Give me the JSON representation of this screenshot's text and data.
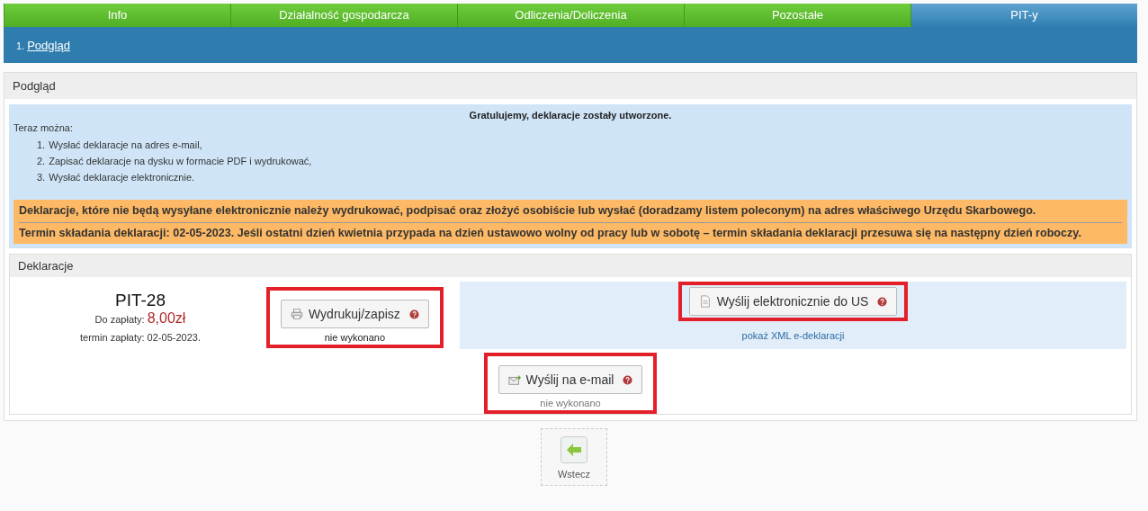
{
  "tabs": [
    {
      "label": "Info",
      "selected": false
    },
    {
      "label": "Działalność gospodarcza",
      "selected": false
    },
    {
      "label": "Odliczenia/Doliczenia",
      "selected": false
    },
    {
      "label": "Pozostałe",
      "selected": false
    },
    {
      "label": "PIT-y",
      "selected": true
    }
  ],
  "steps": [
    {
      "number": "1.",
      "label": "Podgląd",
      "selected": true
    }
  ],
  "preview_panel": {
    "title": "Podgląd",
    "info": {
      "heading": "Gratulujemy, deklaracje zostały utworzone.",
      "intro": "Teraz można:",
      "items": [
        {
          "number": "1.",
          "text": "Wysłać deklaracje na adres e-mail,"
        },
        {
          "number": "2.",
          "text": "Zapisać deklaracje na dysku w formacie PDF i wydrukować,"
        },
        {
          "number": "3.",
          "text": "Wysłać deklaracje elektronicznie."
        }
      ]
    },
    "warnings": [
      "Deklaracje, które nie będą wysyłane elektronicznie należy wydrukować, podpisać oraz złożyć osobiście lub wysłać (doradzamy listem poleconym) na adres właściwego Urzędu Skarbowego.",
      "Termin składania deklaracji: 02-05-2023. Jeśli ostatni dzień kwietnia przypada na dzień ustawowo wolny od pracy lub w sobotę – termin składania deklaracji przesuwa się na następny dzień roboczy."
    ]
  },
  "declarations_panel": {
    "title": "Deklaracje",
    "form": {
      "name": "PIT-28",
      "amount_label": "Do zapłaty:",
      "amount": "8,00zł",
      "due": "termin zapłaty: 02-05-2023."
    },
    "print": {
      "label": "Wydrukuj/zapisz",
      "status": "nie wykonano",
      "highlighted": true
    },
    "edeclaration": {
      "label": "Wyślij elektronicznie do US",
      "link": "pokaż XML e-deklaracji",
      "highlighted": true
    },
    "email": {
      "label": "Wyślij na e-mail",
      "status": "nie wykonano",
      "highlighted": true
    }
  },
  "back_button": {
    "label": "Wstecz"
  }
}
